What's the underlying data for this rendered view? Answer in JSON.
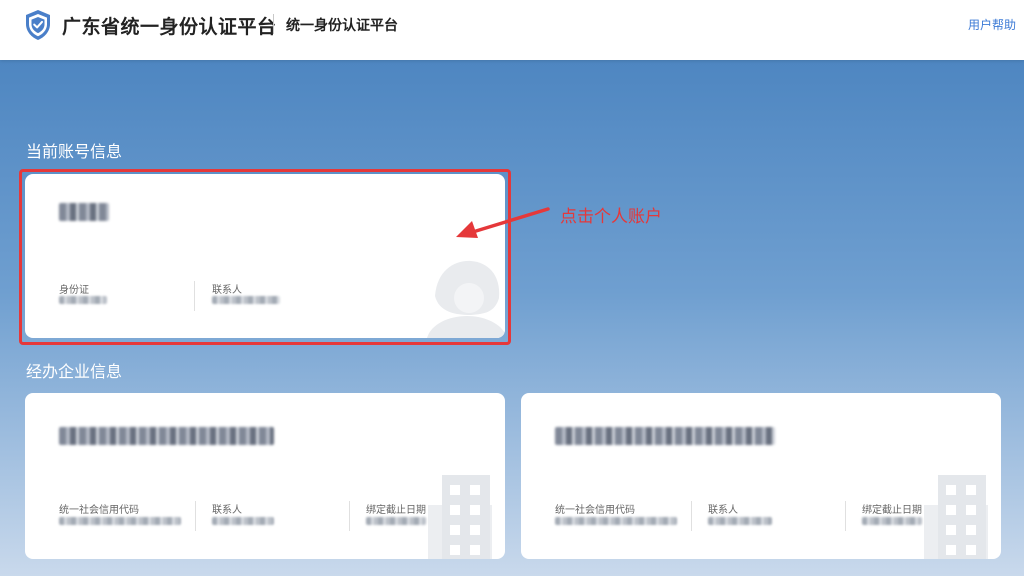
{
  "header": {
    "title": "广东省统一身份认证平台",
    "subtitle": "统一身份认证平台",
    "help": "用户帮助"
  },
  "current_account": {
    "section_title": "当前账号信息",
    "fields": [
      {
        "label": "身份证"
      },
      {
        "label": "联系人"
      }
    ]
  },
  "annotation": {
    "text": "点击个人账户",
    "color": "#e5383a"
  },
  "enterprise": {
    "section_title": "经办企业信息",
    "cards": [
      {
        "fields": [
          {
            "label": "统一社会信用代码"
          },
          {
            "label": "联系人"
          },
          {
            "label": "绑定截止日期"
          }
        ]
      },
      {
        "fields": [
          {
            "label": "统一社会信用代码"
          },
          {
            "label": "联系人"
          },
          {
            "label": "绑定截止日期"
          }
        ]
      }
    ]
  },
  "icons": [
    "shield-check-icon",
    "person-avatar-icon",
    "building-icon",
    "arrow-icon"
  ],
  "colors": {
    "accent": "#3d7bd6",
    "background_top": "#4e86c1",
    "shield": "#4a7fc9"
  }
}
